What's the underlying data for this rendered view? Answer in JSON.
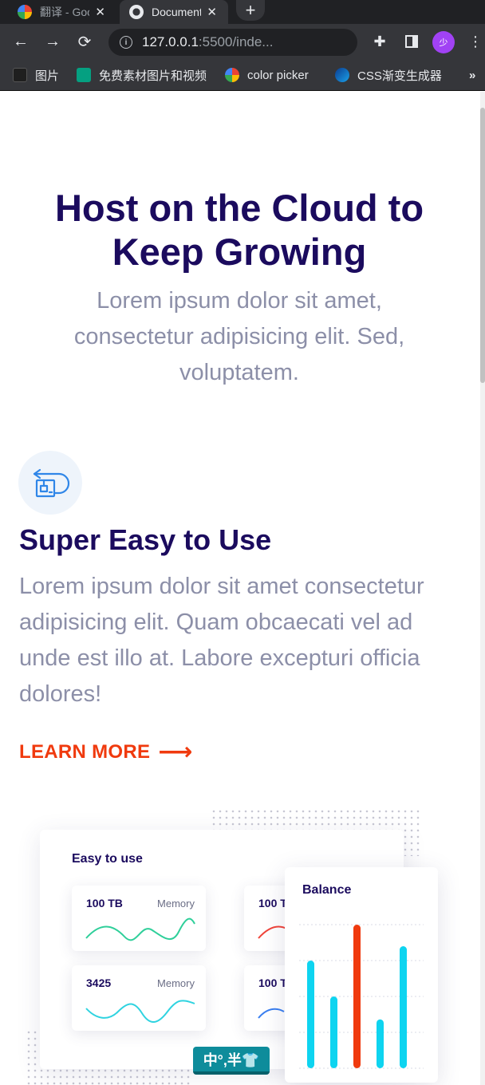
{
  "browser": {
    "tabs": [
      {
        "title": "翻译 - Google",
        "state": "inactive"
      },
      {
        "title": "Document",
        "state": "active"
      }
    ],
    "url": {
      "host": "127.0.0.1",
      "rest": ":5500/inde..."
    },
    "avatar_text": "少",
    "bookmarks": [
      {
        "label": "图片",
        "icon": "images-icon"
      },
      {
        "label": "免费素材图片和视频",
        "icon": "pexels-icon"
      },
      {
        "label": "color picker",
        "icon": "google-icon"
      },
      {
        "label": "CSS渐变生成器",
        "icon": "gradient-icon"
      }
    ],
    "more_bookmarks": "»"
  },
  "hero": {
    "title": "Host on the Cloud to Keep Growing",
    "subtitle": "Lorem ipsum dolor sit amet, consectetur adipisicing elit. Sed, voluptatem."
  },
  "feature": {
    "icon": "cloud-return-box-icon",
    "title": "Super Easy to Use",
    "text": "Lorem ipsum dolor sit amet consectetur adipisicing elit. Quam obcaecati vel ad unde est illo at. Labore excepturi officia dolores!",
    "cta": "LEARN MORE",
    "cta_arrow": "⟶"
  },
  "illustration": {
    "dashboard_title": "Easy to use",
    "stats": [
      {
        "value": "100 TB",
        "label": "Memory",
        "color": "#2fcf9a"
      },
      {
        "value": "100 T",
        "label": "",
        "color": "#f0443a"
      },
      {
        "value": "3425",
        "label": "Memory",
        "color": "#2fd3e0"
      },
      {
        "value": "100 T",
        "label": "",
        "color": "#3a7ff0"
      }
    ],
    "balance": {
      "title": "Balance",
      "bars": [
        0.75,
        0.5,
        1.0,
        0.34,
        0.85
      ],
      "highlight_index": 2,
      "bar_color": "#0ed4f0",
      "highlight_color": "#f03a0e"
    },
    "ime_text": "中°,半👕"
  },
  "colors": {
    "heading": "#1b0b5e",
    "body_text": "#8c8fa8",
    "accent": "#f03a0e"
  }
}
